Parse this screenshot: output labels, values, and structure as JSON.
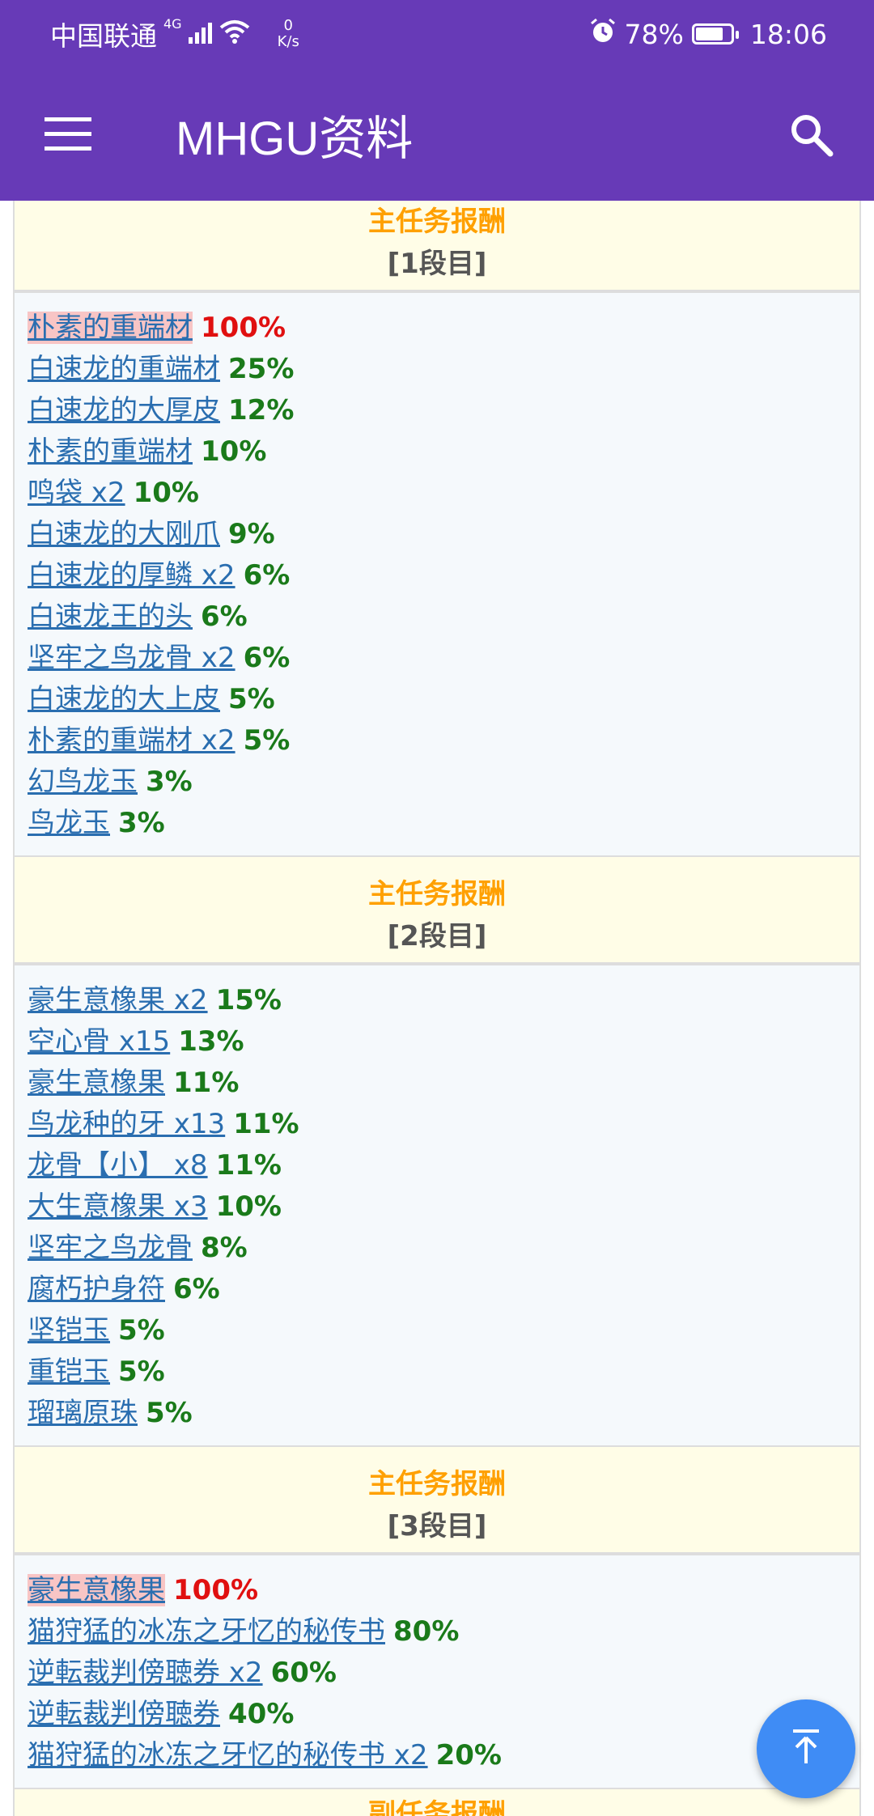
{
  "status": {
    "carrier": "中国联通",
    "network": "4G",
    "speed_value": "0",
    "speed_unit": "K/s",
    "battery": "78%",
    "battery_level": 0.78,
    "time": "18:06"
  },
  "appbar": {
    "title": "MHGU资料"
  },
  "sections": [
    {
      "title": "主任务报酬",
      "subtitle": "[1段目]",
      "items": [
        {
          "name": "朴素的重端材",
          "pct": "100%"
        },
        {
          "name": "白速龙的重端材",
          "pct": "25%"
        },
        {
          "name": "白速龙的大厚皮",
          "pct": "12%"
        },
        {
          "name": "朴素的重端材",
          "pct": "10%"
        },
        {
          "name": "鸣袋 x2",
          "pct": "10%"
        },
        {
          "name": "白速龙的大刚爪",
          "pct": "9%"
        },
        {
          "name": "白速龙的厚鳞 x2",
          "pct": "6%"
        },
        {
          "name": "白速龙王的头",
          "pct": "6%"
        },
        {
          "name": "坚牢之鸟龙骨 x2",
          "pct": "6%"
        },
        {
          "name": "白速龙的大上皮",
          "pct": "5%"
        },
        {
          "name": "朴素的重端材 x2",
          "pct": "5%"
        },
        {
          "name": "幻鸟龙玉",
          "pct": "3%"
        },
        {
          "name": "鸟龙玉",
          "pct": "3%"
        }
      ]
    },
    {
      "title": "主任务报酬",
      "subtitle": "[2段目]",
      "items": [
        {
          "name": "豪生意橡果 x2",
          "pct": "15%"
        },
        {
          "name": "空心骨 x15",
          "pct": "13%"
        },
        {
          "name": "豪生意橡果",
          "pct": "11%"
        },
        {
          "name": "鸟龙种的牙 x13",
          "pct": "11%"
        },
        {
          "name": "龙骨【小】 x8",
          "pct": "11%"
        },
        {
          "name": "大生意橡果 x3",
          "pct": "10%"
        },
        {
          "name": "坚牢之鸟龙骨",
          "pct": "8%"
        },
        {
          "name": "腐朽护身符",
          "pct": "6%"
        },
        {
          "name": "坚铠玉",
          "pct": "5%"
        },
        {
          "name": "重铠玉",
          "pct": "5%"
        },
        {
          "name": "瑠璃原珠",
          "pct": "5%"
        }
      ]
    },
    {
      "title": "主任务报酬",
      "subtitle": "[3段目]",
      "items": [
        {
          "name": "豪生意橡果",
          "pct": "100%"
        },
        {
          "name": "猫狩猛的冰冻之牙忆的秘传书",
          "pct": "80%"
        },
        {
          "name": "逆転裁判傍聴券 x2",
          "pct": "60%"
        },
        {
          "name": "逆転裁判傍聴券",
          "pct": "40%"
        },
        {
          "name": "猫狩猛的冰冻之牙忆的秘传书 x2",
          "pct": "20%"
        }
      ]
    },
    {
      "title": "副任务报酬",
      "subtitle": "",
      "items": []
    }
  ]
}
